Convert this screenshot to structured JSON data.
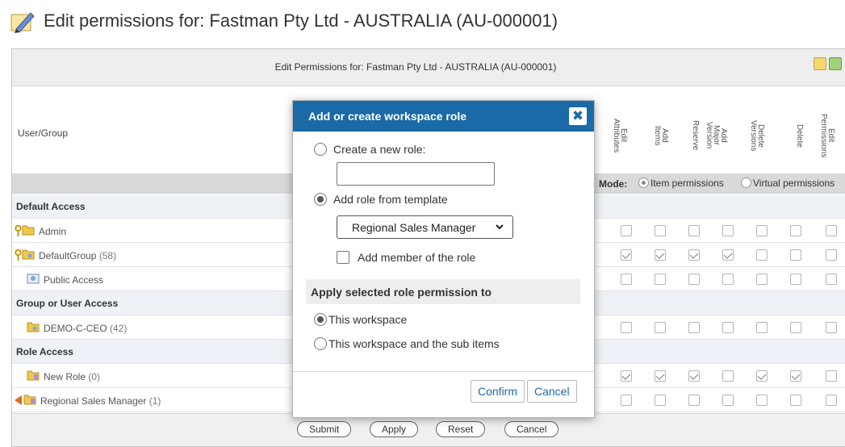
{
  "page": {
    "title": "Edit permissions for: Fastman Pty Ltd - AUSTRALIA (AU-000001)",
    "icon": "edit-pencil-icon"
  },
  "panel": {
    "title": "Edit Permissions for: Fastman Pty Ltd - AUSTRALIA (AU-000001)",
    "user_group_header": "User/Group",
    "columns": [
      "Edit\nAttributes",
      "Add\nItems",
      "Reserve",
      "Add\nMajor\nVersion",
      "Delete\nVersions",
      "Delete",
      "Edit\nPermissions"
    ],
    "mode_label": "Mode:",
    "mode_options": [
      "Item permissions",
      "Virtual permissions"
    ],
    "mode_selected": "Item permissions",
    "sections": {
      "default": "Default Access",
      "group": "Group or User Access",
      "role": "Role Access"
    },
    "rows": [
      {
        "name": "Admin",
        "count": "",
        "perms": [
          false,
          false,
          false,
          false,
          false,
          false,
          false
        ]
      },
      {
        "name": "DefaultGroup",
        "count": "(58)",
        "perms": [
          true,
          true,
          true,
          true,
          false,
          false,
          false
        ]
      },
      {
        "name": "Public Access",
        "count": "",
        "perms": [
          false,
          false,
          false,
          false,
          false,
          false,
          false
        ]
      },
      {
        "name": "DEMO-C-CEO",
        "count": "(42)",
        "perms": [
          false,
          false,
          false,
          false,
          false,
          false,
          false
        ]
      },
      {
        "name": "New Role",
        "count": "(0)",
        "perms": [
          true,
          true,
          true,
          false,
          true,
          true,
          false
        ]
      },
      {
        "name": "Regional Sales Manager",
        "count": "(1)",
        "perms": [
          false,
          false,
          false,
          false,
          false,
          false,
          false
        ]
      }
    ],
    "buttons": {
      "submit": "Submit",
      "apply": "Apply",
      "reset": "Reset",
      "cancel": "Cancel"
    }
  },
  "modal": {
    "title": "Add or create workspace role",
    "close": "✖",
    "create_new_label": "Create a new role:",
    "new_role_value": "",
    "from_template_label": "Add role from template",
    "template_selected": "Regional Sales Manager",
    "add_member_label": "Add member of the role",
    "apply_section_title": "Apply selected role permission to",
    "apply_options": [
      "This workspace",
      "This workspace and the sub items"
    ],
    "confirm": "Confirm",
    "cancel": "Cancel"
  },
  "colors": {
    "modal_header": "#1a6aa8",
    "section_bg": "#eef1f5",
    "folder_yellow": "#f2c84b"
  }
}
